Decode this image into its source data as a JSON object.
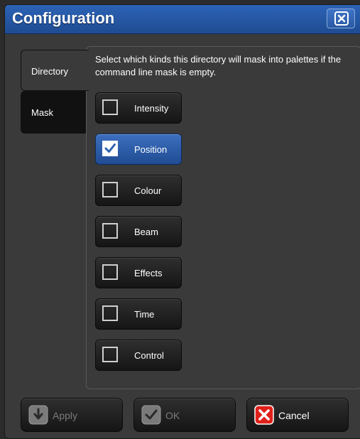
{
  "window": {
    "title": "Configuration"
  },
  "tabs": [
    {
      "label": "Directory",
      "selected": true
    },
    {
      "label": "Mask",
      "selected": false
    }
  ],
  "panel": {
    "description": "Select which kinds this directory will mask into palettes if the command line mask is empty.",
    "options": [
      {
        "label": "Intensity",
        "checked": false
      },
      {
        "label": "Position",
        "checked": true
      },
      {
        "label": "Colour",
        "checked": false
      },
      {
        "label": "Beam",
        "checked": false
      },
      {
        "label": "Effects",
        "checked": false
      },
      {
        "label": "Time",
        "checked": false
      },
      {
        "label": "Control",
        "checked": false
      }
    ]
  },
  "footer": {
    "apply_label": "Apply",
    "ok_label": "OK",
    "cancel_label": "Cancel"
  },
  "colors": {
    "title_bar": "#1f4c92",
    "selected_option": "#2f63b0",
    "cancel_icon": "#e0201a"
  }
}
